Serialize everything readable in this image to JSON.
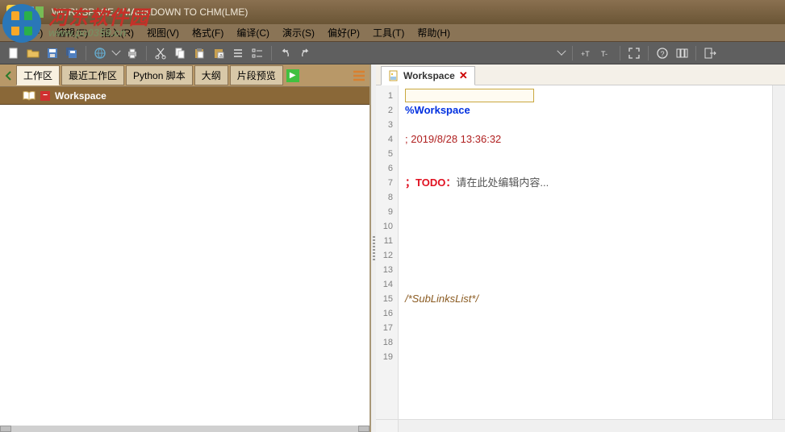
{
  "titlebar": {
    "text": "WORKSPACE - MARKDOWN TO CHM(LME)"
  },
  "watermark": {
    "cn": "河东软件园",
    "url": "www.pc0359.cn"
  },
  "menu": {
    "file": "文件(F)",
    "edit": "编辑(E)",
    "insert": "插入(R)",
    "view": "视图(V)",
    "format": "格式(F)",
    "compile": "编译(C)",
    "demo": "演示(S)",
    "pref": "偏好(P)",
    "tools": "工具(T)",
    "help": "帮助(H)"
  },
  "left_tabs": {
    "workspace": "工作区",
    "recent": "最近工作区",
    "python": "Python 脚本",
    "outline": "大纲",
    "preview": "片段预览"
  },
  "tree": {
    "root_label": "Workspace"
  },
  "editor": {
    "tab_title": "Workspace",
    "lines": {
      "l2": "%Workspace",
      "l4_prefix": "; ",
      "l4_date": "2019/8/28 13:36:32",
      "l7_prefix": "；",
      "l7_todo": "TODO：",
      "l7_rest": "请在此处编辑内容...",
      "l15": "/*SubLinksList*/"
    },
    "line_numbers": [
      "1",
      "2",
      "3",
      "4",
      "5",
      "6",
      "7",
      "8",
      "9",
      "10",
      "11",
      "12",
      "13",
      "14",
      "15",
      "16",
      "17",
      "18",
      "19"
    ]
  }
}
